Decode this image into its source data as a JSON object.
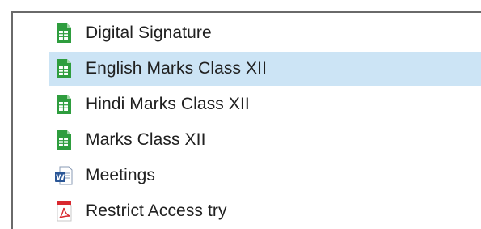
{
  "files": [
    {
      "name": "Digital Signature",
      "icon": "spreadsheet-icon",
      "selected": false
    },
    {
      "name": "English Marks Class XII",
      "icon": "spreadsheet-icon",
      "selected": true
    },
    {
      "name": "Hindi Marks Class XII",
      "icon": "spreadsheet-icon",
      "selected": false
    },
    {
      "name": "Marks Class XII",
      "icon": "spreadsheet-icon",
      "selected": false
    },
    {
      "name": "Meetings",
      "icon": "word-document-icon",
      "selected": false
    },
    {
      "name": "Restrict Access try",
      "icon": "pdf-icon",
      "selected": false
    }
  ],
  "colors": {
    "selection": "#cce4f5",
    "spreadsheet_green": "#2e9d3e",
    "word_blue": "#2b5797",
    "pdf_red": "#d9282f"
  }
}
